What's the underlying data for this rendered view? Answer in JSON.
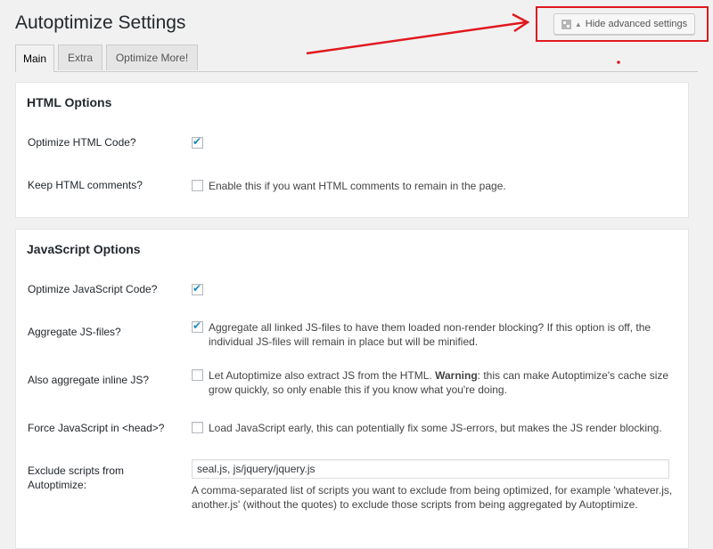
{
  "page": {
    "title": "Autoptimize Settings",
    "advanced_toggle": "Hide advanced settings"
  },
  "tabs": [
    {
      "label": "Main",
      "active": true
    },
    {
      "label": "Extra",
      "active": false
    },
    {
      "label": "Optimize More!",
      "active": false
    }
  ],
  "html_options": {
    "heading": "HTML Options",
    "optimize_html": {
      "label": "Optimize HTML Code?",
      "checked": true
    },
    "keep_comments": {
      "label": "Keep HTML comments?",
      "checked": false,
      "description": "Enable this if you want HTML comments to remain in the page."
    }
  },
  "js_options": {
    "heading": "JavaScript Options",
    "optimize_js": {
      "label": "Optimize JavaScript Code?",
      "checked": true
    },
    "aggregate_js": {
      "label": "Aggregate JS-files?",
      "checked": true,
      "description_line1": "Aggregate all linked JS-files to have them loaded non-render blocking? If this option is off, the",
      "description_line2": "individual JS-files will remain in place but will be minified."
    },
    "aggregate_inline": {
      "label": "Also aggregate inline JS?",
      "checked": false,
      "description_pre": "Let Autoptimize also extract JS from the HTML. ",
      "warning_word": "Warning",
      "description_post": ": this can make Autoptimize's cache size",
      "description_line2": "grow quickly, so only enable this if you know what you're doing."
    },
    "force_head": {
      "label": "Force JavaScript in <head>?",
      "checked": false,
      "description": "Load JavaScript early, this can potentially fix some JS-errors, but makes the JS render blocking."
    },
    "exclude": {
      "label_line1": "Exclude scripts from",
      "label_line2": "Autoptimize:",
      "value": "seal.js, js/jquery/jquery.js",
      "note_line1": "A comma-separated list of scripts you want to exclude from being optimized, for example 'whatever.js,",
      "note_line2": "another.js' (without the quotes) to exclude those scripts from being aggregated by Autoptimize."
    }
  },
  "colors": {
    "annotation_red": "#e0191f",
    "checkmark_blue": "#1e8cbe",
    "page_bg": "#f1f1f1"
  }
}
